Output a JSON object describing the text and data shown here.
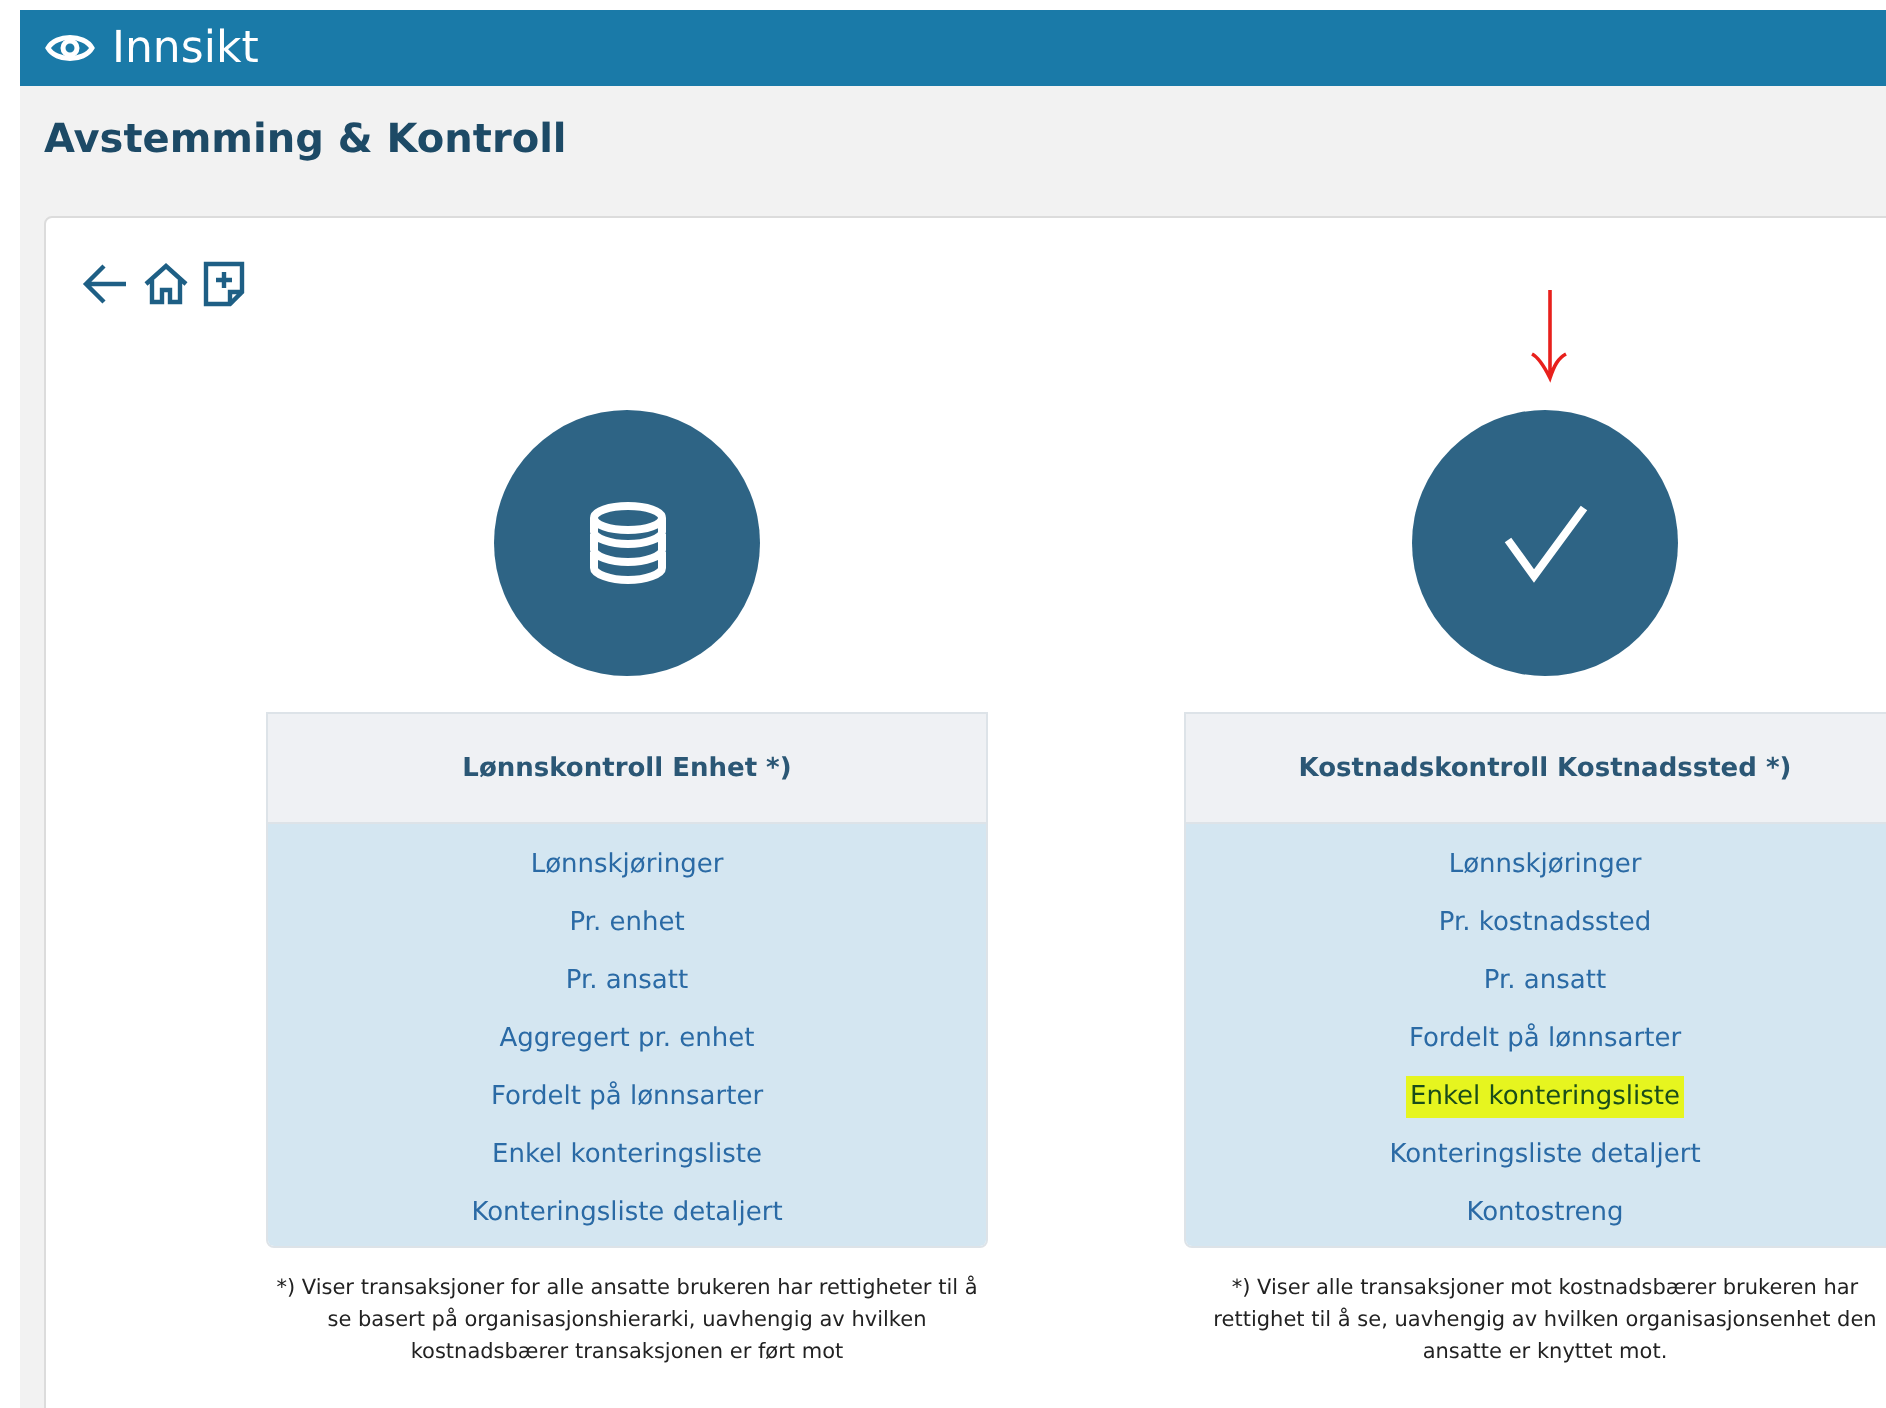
{
  "app_bar": {
    "title": "Innsikt"
  },
  "page_title": "Avstemming & Kontroll",
  "panels": [
    {
      "kind": "coins",
      "title": "Lønnskontroll Enhet *)",
      "items": [
        {
          "label": "Lønnskjøringer",
          "highlighted": false
        },
        {
          "label": "Pr. enhet",
          "highlighted": false
        },
        {
          "label": "Pr. ansatt",
          "highlighted": false
        },
        {
          "label": "Aggregert pr. enhet",
          "highlighted": false
        },
        {
          "label": "Fordelt på lønnsarter",
          "highlighted": false
        },
        {
          "label": "Enkel konteringsliste",
          "highlighted": false
        },
        {
          "label": "Konteringsliste detaljert",
          "highlighted": false
        }
      ],
      "footnote": "*) Viser transaksjoner for alle ansatte brukeren har rettigheter til å se basert på organisasjonshierarki, uavhengig av hvilken kostnadsbærer transaksjonen er ført mot"
    },
    {
      "kind": "check",
      "annotation": {
        "kind": "arrow"
      },
      "title": "Kostnadskontroll Kostnadssted *)",
      "items": [
        {
          "label": "Lønnskjøringer",
          "highlighted": false
        },
        {
          "label": "Pr. kostnadssted",
          "highlighted": false
        },
        {
          "label": "Pr. ansatt",
          "highlighted": false
        },
        {
          "label": "Fordelt på lønnsarter",
          "highlighted": false
        },
        {
          "label": "Enkel konteringsliste",
          "highlighted": true
        },
        {
          "label": "Konteringsliste detaljert",
          "highlighted": false
        },
        {
          "label": "Kontostreng",
          "highlighted": false
        }
      ],
      "footnote": "*) Viser alle transaksjoner mot kostnadsbærer brukeren har rettighet til å se, uavhengig av hvilken organisasjonsenhet den ansatte er knyttet mot."
    }
  ]
}
